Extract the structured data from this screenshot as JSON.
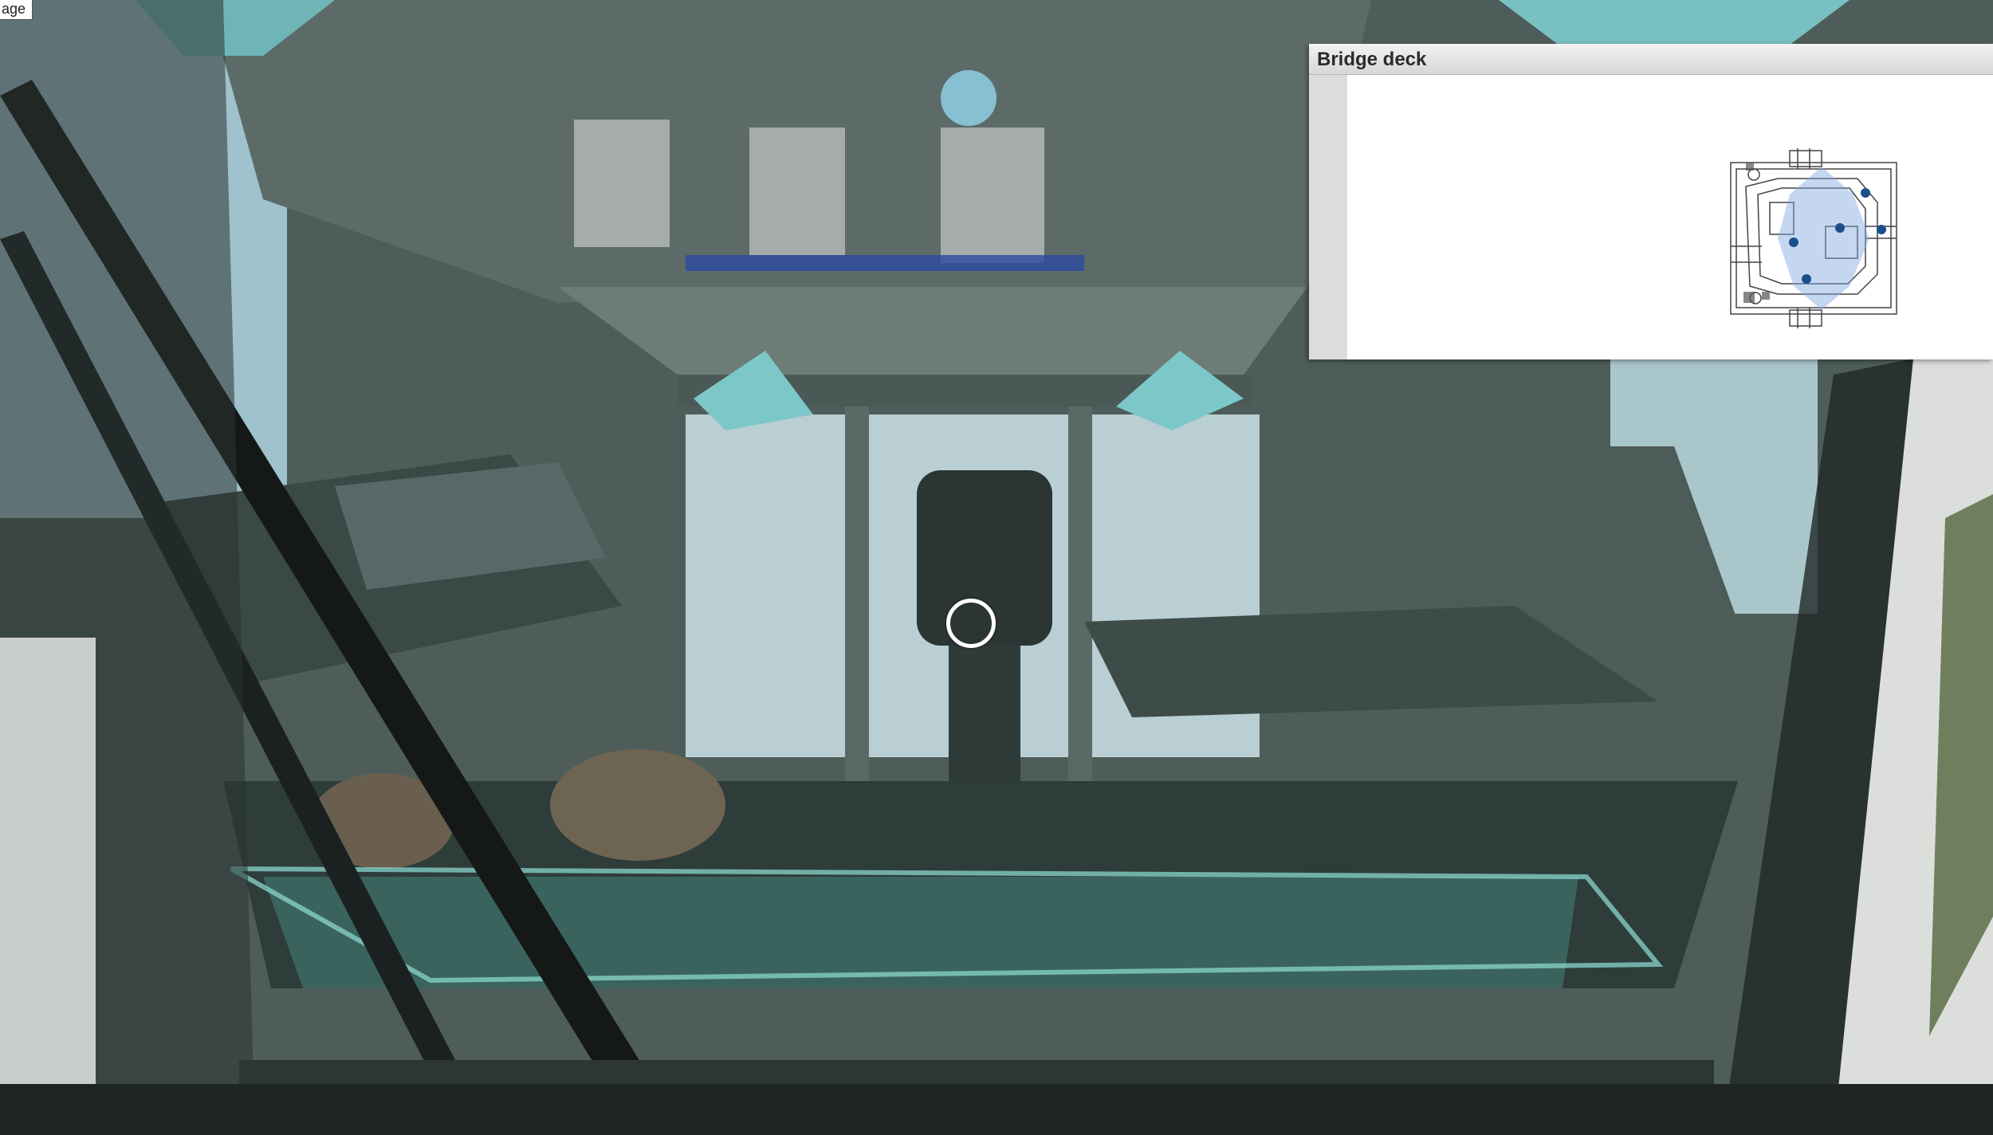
{
  "page_tag": "age",
  "minimap": {
    "title": "Bridge deck"
  },
  "colors": {
    "marker": "#1b4f8c",
    "view_cone": "#7fa3e0",
    "hotspot": "#96dcf5",
    "reticle": "#ffffff"
  },
  "icons": {
    "reticle": "circle-reticle-icon",
    "hotspot": "circle-hotspot-icon",
    "marker": "position-marker-icon"
  }
}
